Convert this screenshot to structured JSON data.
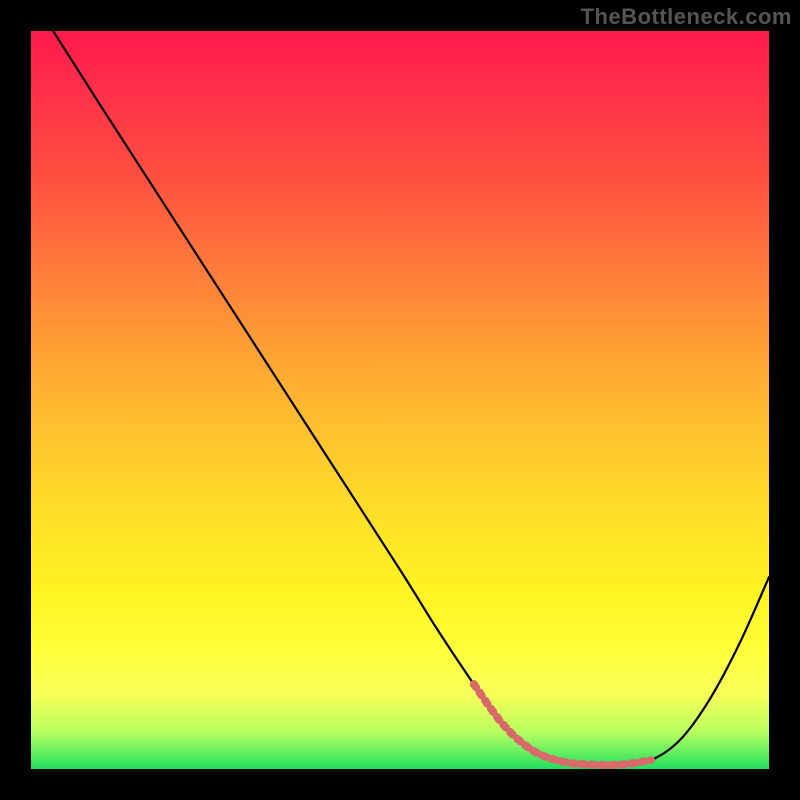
{
  "watermark": "TheBottleneck.com",
  "chart_data": {
    "type": "line",
    "title": "",
    "xlabel": "",
    "ylabel": "",
    "xlim": [
      0,
      100
    ],
    "ylim": [
      0,
      100
    ],
    "series": [
      {
        "name": "bottleneck-curve",
        "color": "#000000",
        "x": [
          3,
          10,
          20,
          30,
          40,
          50,
          55,
          60,
          64,
          68,
          72,
          76,
          80,
          84,
          88,
          92,
          96,
          100
        ],
        "values": [
          100,
          89,
          73.5,
          58,
          42.5,
          27,
          19,
          11.5,
          6,
          2.5,
          1,
          0.6,
          0.6,
          1.2,
          4,
          9.5,
          17,
          26
        ]
      },
      {
        "name": "highlight-flat-region",
        "color": "#d96a6a",
        "x": [
          60,
          64,
          68,
          72,
          76,
          80,
          84
        ],
        "values": [
          11.5,
          6,
          2.5,
          1,
          0.6,
          0.6,
          1.2
        ]
      }
    ]
  },
  "colors": {
    "background": "#000000",
    "gradient_top": "#ff1a4d",
    "gradient_bottom": "#20e060",
    "curve": "#000000",
    "highlight": "#d96a6a",
    "watermark": "#555555"
  }
}
